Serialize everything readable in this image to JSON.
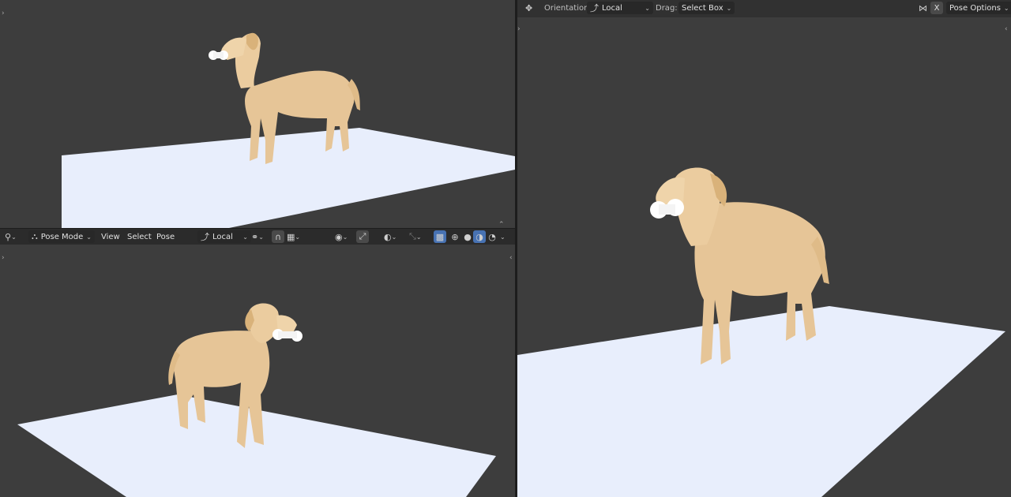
{
  "colors": {
    "viewport_bg": "#3d3d3d",
    "header_bg": "#2b2b2b",
    "floor": "#e8eefc",
    "dog_fur": "#e8c99a",
    "accent": "#4772b3"
  },
  "bottom_left_header": {
    "editor_icon": "camera-view-icon",
    "mode_label": "Pose Mode",
    "menus": [
      "View",
      "Select",
      "Pose"
    ],
    "orientation_label": "Local",
    "transform_pivot_icon": "link-icon",
    "snap_icon": "magnet-icon",
    "proportional_icon": "grid-icon",
    "visibility_icon": "eye-icon",
    "gizmo_icon": "gizmo-icon",
    "overlay_icon": "overlay-icon",
    "xray_icon": "xray-icon",
    "shading_icons": [
      "wireframe-icon",
      "solid-icon",
      "material-icon",
      "rendered-icon"
    ]
  },
  "right_header": {
    "tool_icon": "move-icon",
    "orientation_label": "Orientation:",
    "orientation_value": "Local",
    "drag_label": "Drag:",
    "drag_value": "Select Box",
    "mirror_label": "X",
    "pose_options_label": "Pose Options"
  }
}
